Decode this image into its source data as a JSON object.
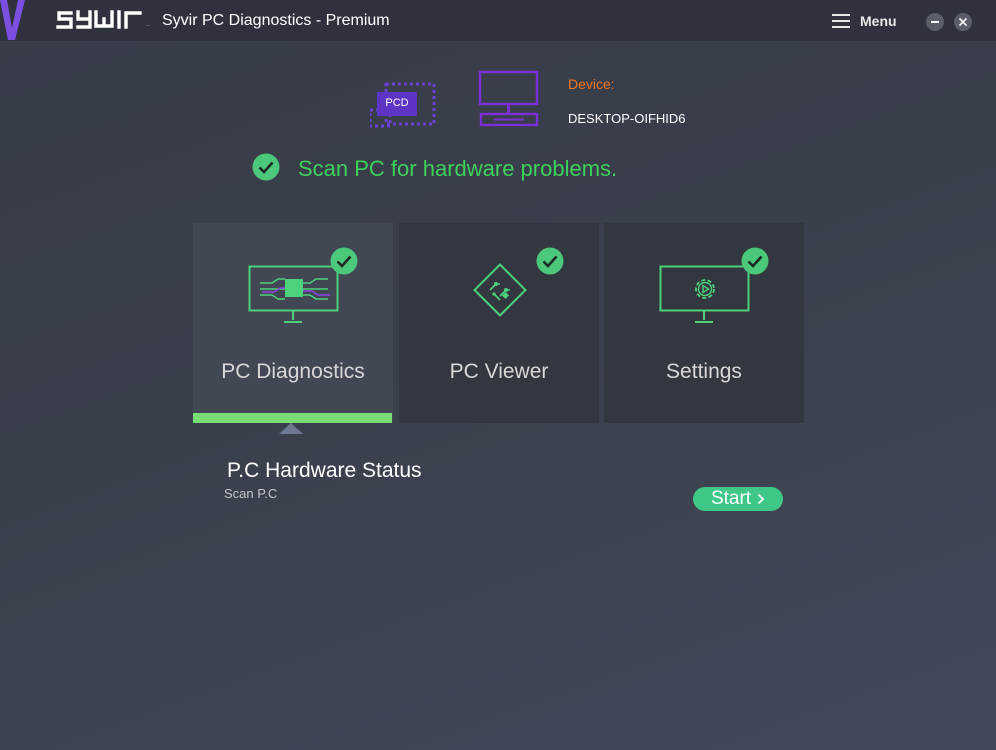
{
  "app": {
    "logo_text": "SYWIR",
    "title": "Syvir PC Diagnostics - Premium",
    "menu_label": "Menu"
  },
  "device": {
    "badge": "PCD",
    "label": "Device:",
    "name": "DESKTOP-OIFHID6"
  },
  "headline": "Scan PC for hardware problems.",
  "cards": [
    {
      "label": "PC Diagnostics",
      "active": true
    },
    {
      "label": "PC Viewer",
      "active": false
    },
    {
      "label": "Settings",
      "active": false
    }
  ],
  "section": {
    "title": "P.C Hardware Status",
    "subtitle": "Scan P.C",
    "start_label": "Start"
  },
  "colors": {
    "accent_green": "#3ed15a",
    "check_green": "#4cc87a",
    "button_green": "#3ec786",
    "active_bar": "#79dd77",
    "purple": "#7b2fd6",
    "device_label": "#f5761a"
  },
  "icons": {
    "menu": "hamburger-icon",
    "minimize": "minimize-icon",
    "close": "close-icon",
    "check": "check-circle-icon",
    "start_arrow": "chevron-right-icon"
  }
}
